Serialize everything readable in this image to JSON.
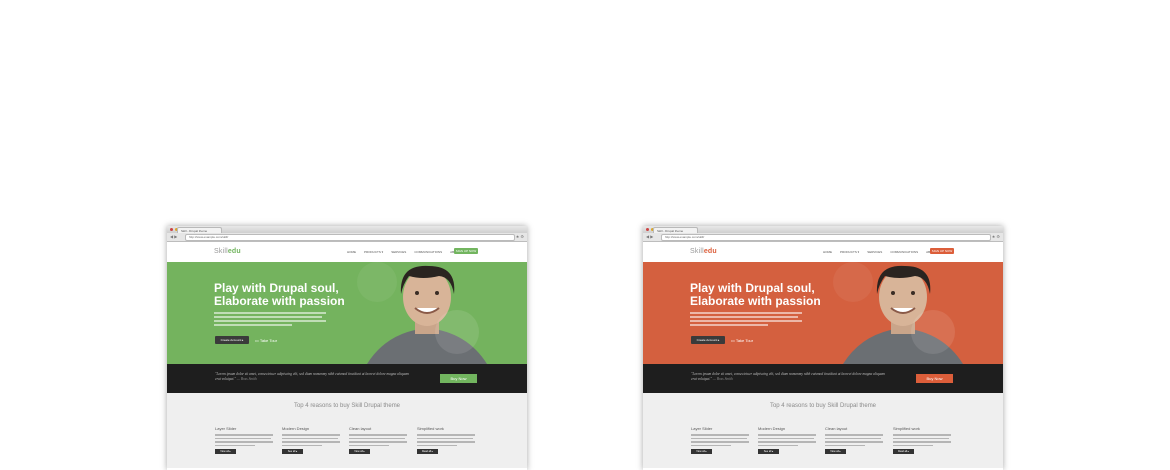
{
  "browser": {
    "tab_title": "Skill - Drupal theme",
    "url": "http://www.example.com/skill/",
    "nav_glyphs": "◀ ▶",
    "tool_glyphs": "★ ⚙"
  },
  "site": {
    "logo_main": "Skill",
    "logo_accent": "edu",
    "menu": [
      "HOME",
      "PRODUCTS ▾",
      "SERVICES",
      "COMMUNICATIONS",
      "ABOUT US"
    ],
    "signup_label": "SIGN UP NOW"
  },
  "hero": {
    "headline_1": "Play with Drupal soul,",
    "headline_2": "Elaborate with passion",
    "cta_label": "Create Account ▸",
    "tour_label": "Take Tour"
  },
  "quote": {
    "text": "\"Lorem ipsum dolor sit amet, consectetuer adipiscing elit, sed diam nonummy nibh euismod tincidunt ut laoreet dolore magna aliquam erat volutpat.\"",
    "author": "— Boss Smith",
    "buy_label": "Buy Now"
  },
  "reasons": {
    "title": "Top 4 reasons to buy Skill Drupal theme",
    "features": [
      {
        "name": "Layer Slider",
        "button": "View all ▸"
      },
      {
        "name": "Modern Design",
        "button": "See all ▸"
      },
      {
        "name": "Clean layout",
        "button": "View all ▸"
      },
      {
        "name": "Simplified work",
        "button": "Read all ▸"
      }
    ]
  },
  "themes": [
    {
      "name": "green",
      "hero_color": "#74b35e",
      "accent": "#72b55f"
    },
    {
      "name": "orange",
      "hero_color": "#d4603f",
      "accent": "#dc5e3a"
    }
  ]
}
